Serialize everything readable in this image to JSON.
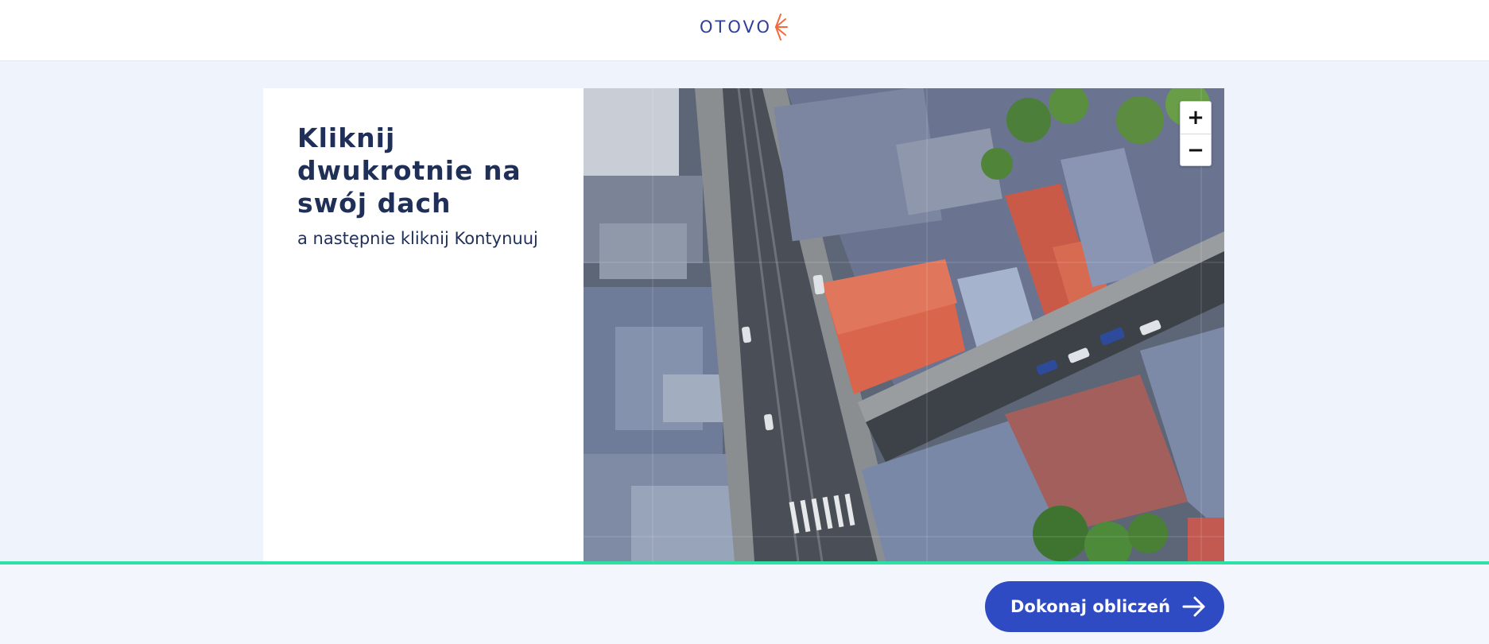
{
  "header": {
    "logo_text": "OTOVO"
  },
  "instructions": {
    "title": "Kliknij dwukrotnie na swój dach",
    "subtitle": "a następnie kliknij Kontynuuj"
  },
  "map": {
    "zoom_in_label": "+",
    "zoom_out_label": "−"
  },
  "footer": {
    "cta_label": "Dokonaj obliczeń"
  },
  "colors": {
    "brand_blue": "#2f4bc4",
    "accent_green": "#29e2a4",
    "logo_orange": "#f26a3d",
    "text_navy": "#1f2f57"
  }
}
